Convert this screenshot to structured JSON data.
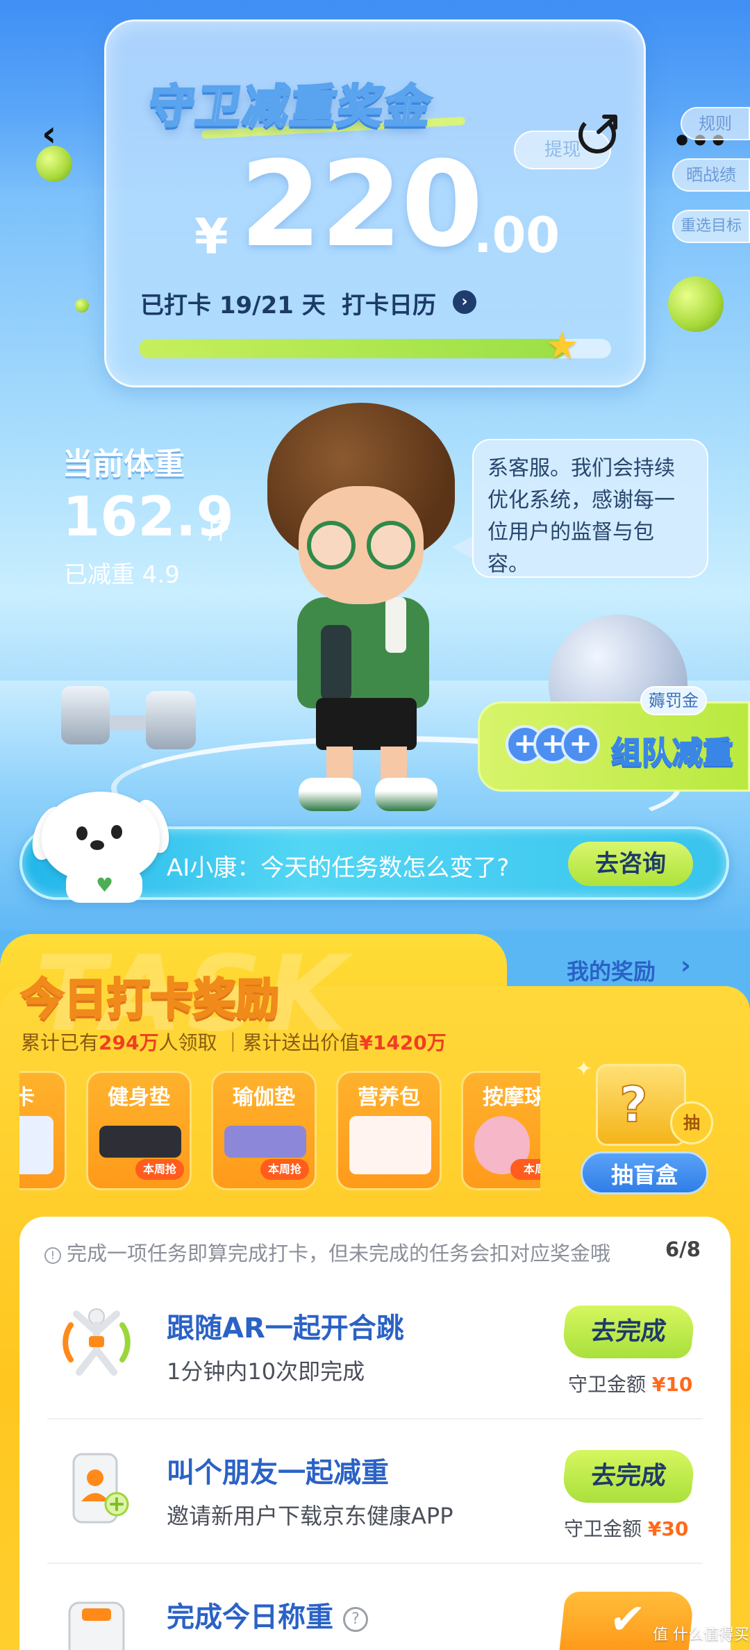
{
  "header": {
    "title": "守卫减重奖金",
    "withdraw_label": "提现",
    "more_label": "•••"
  },
  "side_menu": {
    "rules": "规则",
    "show_results": "晒战绩",
    "reset_goal": "重选目标"
  },
  "bonus": {
    "currency": "¥",
    "amount_int": "220",
    "amount_dec": ".00",
    "checkin_prefix": "已打卡",
    "checkin_days": "19/21",
    "checkin_suffix": "天",
    "calendar_label": "打卡日历",
    "progress": 0.905
  },
  "weight": {
    "label": "当前体重",
    "value": "162.9",
    "unit": "斤",
    "lost": "已减重 4.9"
  },
  "bubble": {
    "text": "系客服。我们会持续优化系统，感谢每一位用户的监督与包容。"
  },
  "team": {
    "label": "组队减重",
    "badge": "薅罚金"
  },
  "ai": {
    "prompt": "AI小康：今天的任务数怎么变了?",
    "button": "去咨询"
  },
  "rewards": {
    "title": "今日打卡奖励",
    "watermark": "TASK",
    "my_rewards": "我的奖励",
    "stats_prefix": "累计已有",
    "stats_people": "294万",
    "stats_mid": "人领取 ｜累计送出价值",
    "stats_value": "¥1420万",
    "items": [
      {
        "name": "等卡",
        "tag": ""
      },
      {
        "name": "健身垫",
        "tag": "本周抢"
      },
      {
        "name": "瑜伽垫",
        "tag": "本周抢"
      },
      {
        "name": "营养包",
        "tag": ""
      },
      {
        "name": "按摩球",
        "tag": "本周"
      }
    ],
    "blind_box_label": "抽盲盒",
    "blind_box_star": "抽"
  },
  "tasks": {
    "notice": "完成一项任务即算完成打卡，但未完成的任务会扣对应奖金哦",
    "count": "6/8",
    "reward_prefix": "守卫金额",
    "items": [
      {
        "title": "跟随AR一起开合跳",
        "desc": "1分钟内10次即完成",
        "button": "去完成",
        "amount": "¥10"
      },
      {
        "title": "叫个朋友一起减重",
        "desc": "邀请新用户下载京东健康APP",
        "button": "去完成",
        "amount": "¥30"
      },
      {
        "title": "完成今日称重",
        "desc": "",
        "button": "✔",
        "amount": ""
      }
    ]
  },
  "footer": {
    "watermark": "值 什么值得买"
  }
}
